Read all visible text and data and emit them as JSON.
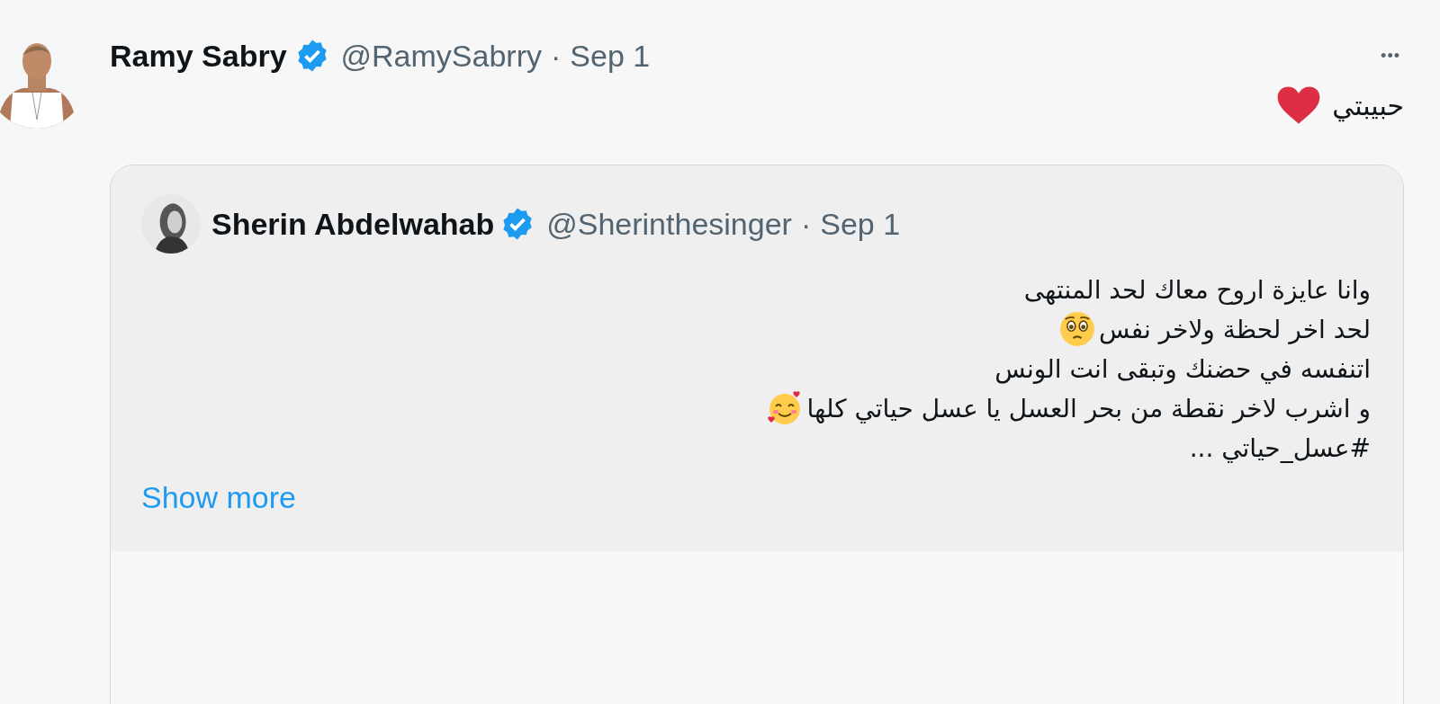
{
  "tweet": {
    "author": "Ramy Sabry",
    "verified": true,
    "handle": "@RamySabrry",
    "separator": "·",
    "date": "Sep 1",
    "more": "•••",
    "body": {
      "text": "حبيبتي",
      "kind": "heart"
    },
    "quote": {
      "author": "Sherin Abdelwahab",
      "verified": true,
      "handle": "@Sherinthesinger",
      "separator": "·",
      "date": "Sep 1",
      "lines": [
        {
          "text": "وانا عايزة اروح معاك لحد المنتهى",
          "kind": "plain"
        },
        {
          "text": "لحد اخر لحظة ولاخر نفس",
          "kind": "teary"
        },
        {
          "text": "اتنفسه في حضنك وتبقى انت الونس",
          "kind": "plain"
        },
        {
          "text": "و اشرب لاخر نقطة من بحر العسل يا عسل حياتي كلها",
          "kind": "hearts"
        },
        {
          "text": "#عسل_حياتي ...",
          "kind": "plain"
        }
      ],
      "show_more": "Show more"
    }
  }
}
